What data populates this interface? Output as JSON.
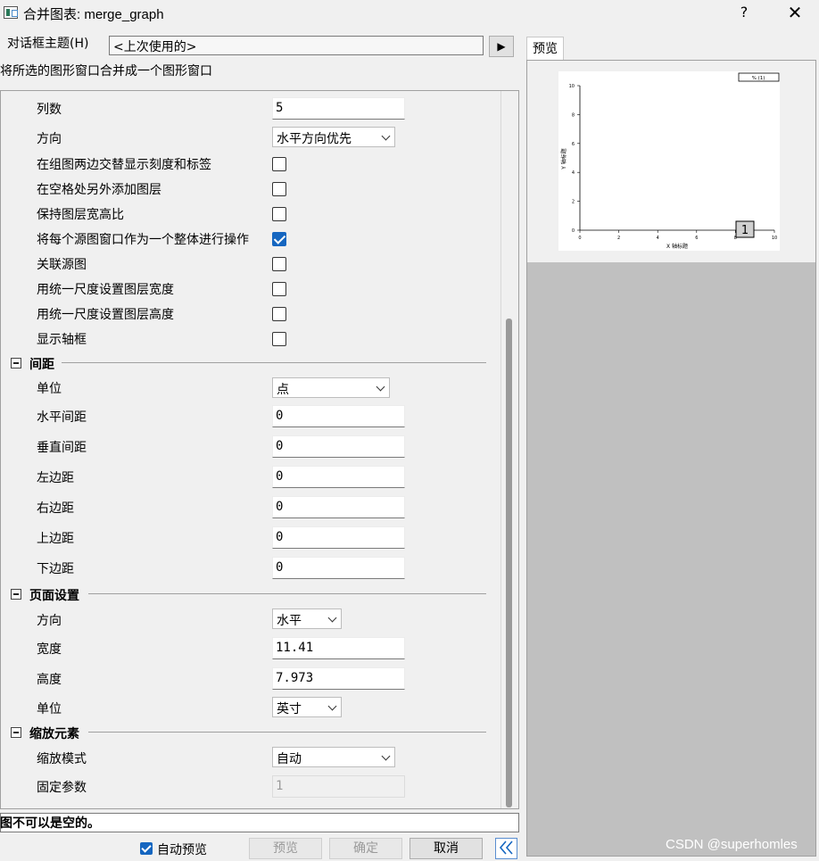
{
  "window": {
    "title": "合并图表: merge_graph",
    "help": "?",
    "close": "✕"
  },
  "theme": {
    "label": "对话框主题(H)",
    "value": "<上次使用的>",
    "menu_arrow": "▶"
  },
  "description": "将所选的图形窗口合并成一个图形窗口",
  "layout": {
    "columns_label": "列数",
    "columns_value": "5",
    "direction_label": "方向",
    "direction_value": "水平方向优先",
    "options": [
      {
        "label": "在组图两边交替显示刻度和标签",
        "checked": false
      },
      {
        "label": "在空格处另外添加图层",
        "checked": false
      },
      {
        "label": "保持图层宽高比",
        "checked": false
      },
      {
        "label": "将每个源图窗口作为一个整体进行操作",
        "checked": true
      },
      {
        "label": "关联源图",
        "checked": false
      },
      {
        "label": "用统一尺度设置图层宽度",
        "checked": false
      },
      {
        "label": "用统一尺度设置图层高度",
        "checked": false
      },
      {
        "label": "显示轴框",
        "checked": false
      }
    ]
  },
  "spacing": {
    "title": "间距",
    "unit_label": "单位",
    "unit_value": "点",
    "fields": [
      {
        "label": "水平间距",
        "value": "0"
      },
      {
        "label": "垂直间距",
        "value": "0"
      },
      {
        "label": "左边距",
        "value": "0"
      },
      {
        "label": "右边距",
        "value": "0"
      },
      {
        "label": "上边距",
        "value": "0"
      },
      {
        "label": "下边距",
        "value": "0"
      }
    ]
  },
  "page_setup": {
    "title": "页面设置",
    "orientation_label": "方向",
    "orientation_value": "水平",
    "width_label": "宽度",
    "width_value": "11.41",
    "height_label": "高度",
    "height_value": "7.973",
    "unit_label": "单位",
    "unit_value": "英寸"
  },
  "scale": {
    "title": "缩放元素",
    "mode_label": "缩放模式",
    "mode_value": "自动",
    "fixed_label": "固定参数",
    "fixed_value": "1"
  },
  "error_message": "图不可以是空的。",
  "footer": {
    "auto_preview_label": "自动预览",
    "auto_preview_checked": true,
    "preview_button": "预览",
    "ok_button": "确定",
    "cancel_button": "取消",
    "collapse_button": "《"
  },
  "preview": {
    "tab_label": "预览",
    "x_axis_title": "X 轴标题",
    "y_axis_title": "Y 轴标题",
    "legend_text": "% (1)",
    "layer_badge": "1",
    "y_ticks": [
      "0",
      "2",
      "4",
      "6",
      "8",
      "10"
    ],
    "x_ticks": [
      "0",
      "2",
      "4",
      "6",
      "8",
      "10"
    ]
  },
  "watermark": "CSDN @superhomles"
}
